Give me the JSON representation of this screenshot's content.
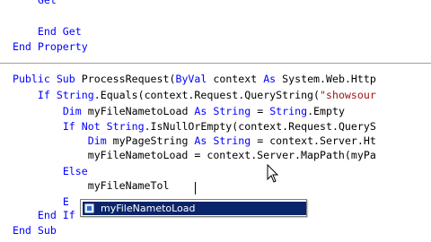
{
  "code_lines": [
    {
      "segments": [
        {
          "t": "      "
        },
        {
          "t": "Get",
          "k": "kw"
        }
      ]
    },
    {
      "segments": [
        {
          "t": ""
        }
      ]
    },
    {
      "segments": [
        {
          "t": "      "
        },
        {
          "t": "End Get",
          "k": "kw"
        }
      ]
    },
    {
      "segments": [
        {
          "t": "  "
        },
        {
          "t": "End Property",
          "k": "kw"
        }
      ]
    },
    {
      "segments": [
        {
          "t": ""
        }
      ]
    },
    {
      "segments": [
        {
          "t": "  "
        },
        {
          "t": "Public Sub",
          "k": "kw"
        },
        {
          "t": " ProcessRequest("
        },
        {
          "t": "ByVal",
          "k": "kw"
        },
        {
          "t": " context "
        },
        {
          "t": "As",
          "k": "kw"
        },
        {
          "t": " System.Web.Http"
        }
      ]
    },
    {
      "segments": [
        {
          "t": "      "
        },
        {
          "t": "If",
          "k": "kw"
        },
        {
          "t": " "
        },
        {
          "t": "String",
          "k": "kw"
        },
        {
          "t": ".Equals(context.Request.QueryString("
        },
        {
          "t": "\"showsour",
          "k": "str"
        }
      ]
    },
    {
      "segments": [
        {
          "t": "          "
        },
        {
          "t": "Dim",
          "k": "kw"
        },
        {
          "t": " myFileNametoLoad "
        },
        {
          "t": "As String",
          "k": "kw"
        },
        {
          "t": " = "
        },
        {
          "t": "String",
          "k": "kw"
        },
        {
          "t": ".Empty"
        }
      ]
    },
    {
      "segments": [
        {
          "t": "          "
        },
        {
          "t": "If Not String",
          "k": "kw"
        },
        {
          "t": ".IsNullOrEmpty(context.Request.QueryS"
        }
      ]
    },
    {
      "segments": [
        {
          "t": "              "
        },
        {
          "t": "Dim",
          "k": "kw"
        },
        {
          "t": " myPageString "
        },
        {
          "t": "As String",
          "k": "kw"
        },
        {
          "t": " = context.Server.Ht"
        }
      ]
    },
    {
      "segments": [
        {
          "t": "              myFileNametoLoad = context.Server.MapPath(myPa"
        }
      ]
    },
    {
      "segments": [
        {
          "t": "          "
        },
        {
          "t": "Else",
          "k": "kw"
        }
      ]
    },
    {
      "segments": [
        {
          "t": "              myFileNameTol"
        }
      ]
    },
    {
      "segments": [
        {
          "t": "          "
        },
        {
          "t": "E",
          "k": "kw"
        }
      ]
    },
    {
      "segments": [
        {
          "t": "      "
        },
        {
          "t": "End If",
          "k": "kw"
        }
      ]
    },
    {
      "segments": [
        {
          "t": "  "
        },
        {
          "t": "End Sub",
          "k": "kw"
        }
      ]
    }
  ],
  "intellisense": {
    "items": [
      "myFileNametoLoad"
    ],
    "selected_index": 0
  },
  "colors": {
    "keyword": "#0000ff",
    "string": "#a31515",
    "selection": "#0a246a"
  }
}
